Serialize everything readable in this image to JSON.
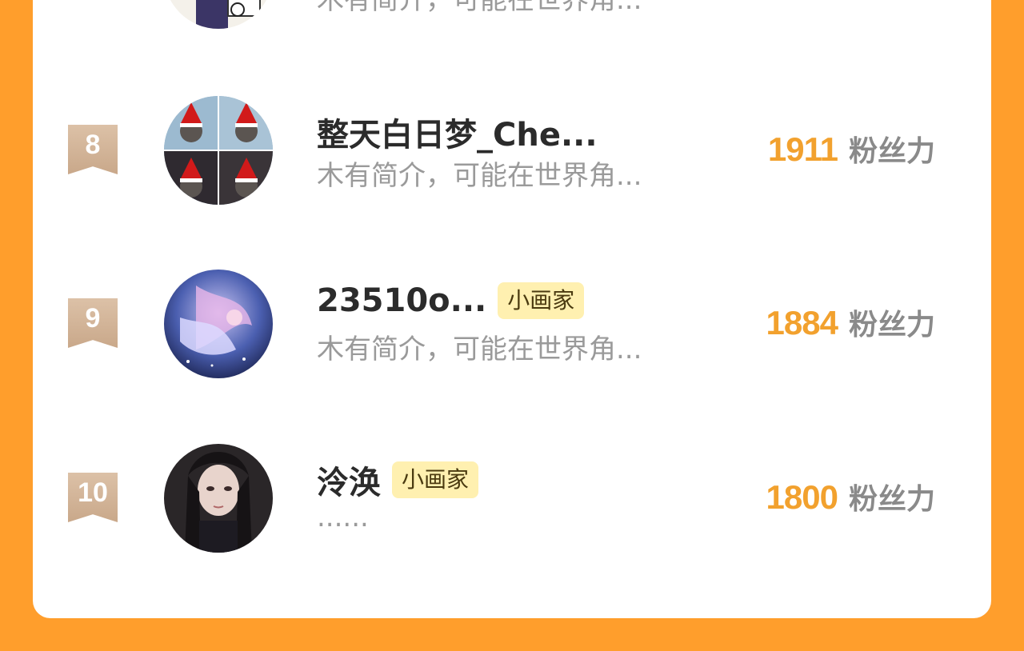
{
  "colors": {
    "background": "#FF9E2C",
    "card": "#FFFFFF",
    "fans_number": "#F2A12E",
    "badge_bg": "#FFF0B0",
    "rank_badge": "#D3B79C"
  },
  "fans_unit": "粉丝力",
  "rows": [
    {
      "rank": "",
      "name": "",
      "badge": "",
      "bio": "木有简介，可能在世界角...",
      "fans": "",
      "avatar_icon": "cartoon-avatar"
    },
    {
      "rank": "8",
      "name": "整天白日梦_Che...",
      "badge": "",
      "bio": "木有简介，可能在世界角...",
      "fans": "1911",
      "avatar_icon": "christmas-cats-collage"
    },
    {
      "rank": "9",
      "name": "23510o...",
      "badge": "小画家",
      "bio": "木有简介，可能在世界角...",
      "fans": "1884",
      "avatar_icon": "anime-girl-blue"
    },
    {
      "rank": "10",
      "name": "泠涣",
      "badge": "小画家",
      "bio": "......",
      "fans": "1800",
      "avatar_icon": "dark-hair-portrait"
    }
  ]
}
